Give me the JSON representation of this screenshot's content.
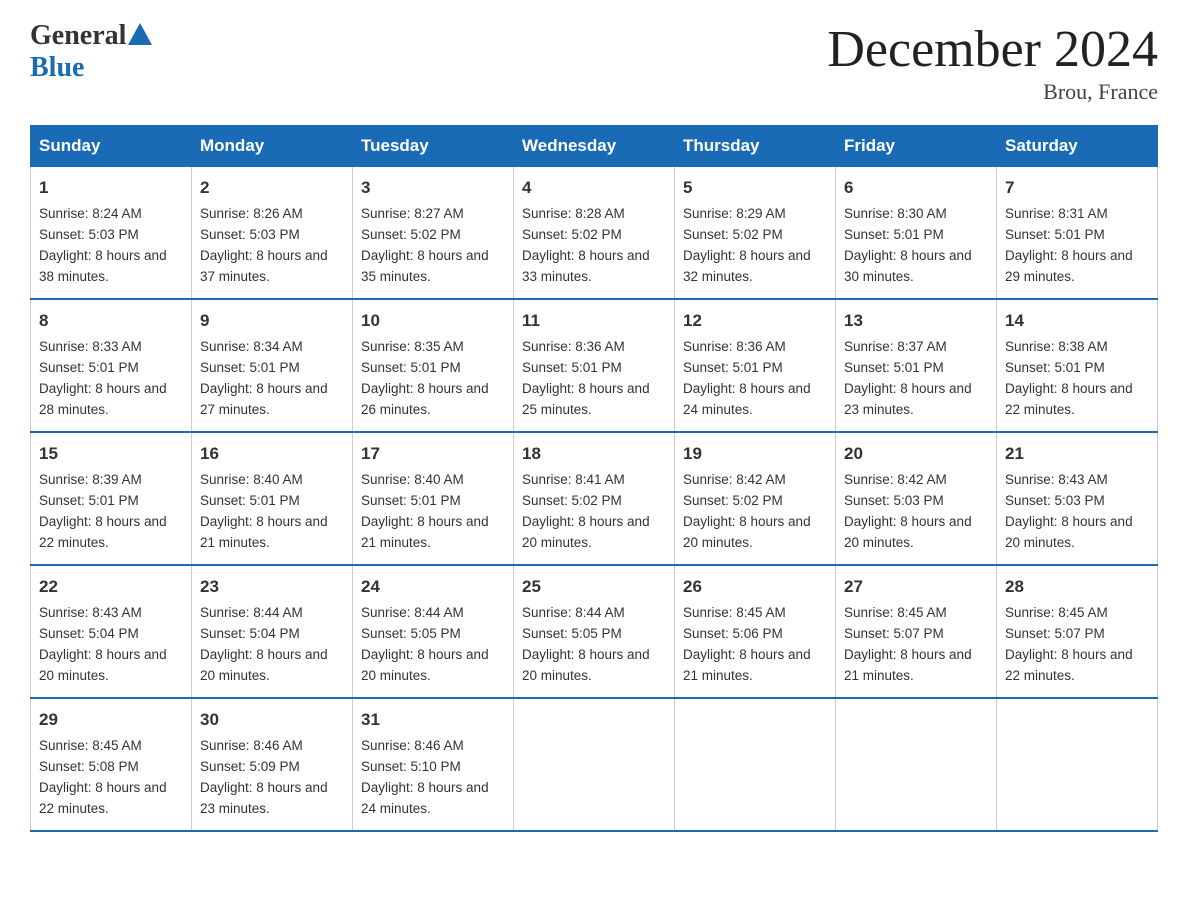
{
  "header": {
    "logo_general": "General",
    "logo_blue": "Blue",
    "title": "December 2024",
    "location": "Brou, France"
  },
  "days_of_week": [
    "Sunday",
    "Monday",
    "Tuesday",
    "Wednesday",
    "Thursday",
    "Friday",
    "Saturday"
  ],
  "weeks": [
    [
      {
        "day": "1",
        "sunrise": "Sunrise: 8:24 AM",
        "sunset": "Sunset: 5:03 PM",
        "daylight": "Daylight: 8 hours and 38 minutes."
      },
      {
        "day": "2",
        "sunrise": "Sunrise: 8:26 AM",
        "sunset": "Sunset: 5:03 PM",
        "daylight": "Daylight: 8 hours and 37 minutes."
      },
      {
        "day": "3",
        "sunrise": "Sunrise: 8:27 AM",
        "sunset": "Sunset: 5:02 PM",
        "daylight": "Daylight: 8 hours and 35 minutes."
      },
      {
        "day": "4",
        "sunrise": "Sunrise: 8:28 AM",
        "sunset": "Sunset: 5:02 PM",
        "daylight": "Daylight: 8 hours and 33 minutes."
      },
      {
        "day": "5",
        "sunrise": "Sunrise: 8:29 AM",
        "sunset": "Sunset: 5:02 PM",
        "daylight": "Daylight: 8 hours and 32 minutes."
      },
      {
        "day": "6",
        "sunrise": "Sunrise: 8:30 AM",
        "sunset": "Sunset: 5:01 PM",
        "daylight": "Daylight: 8 hours and 30 minutes."
      },
      {
        "day": "7",
        "sunrise": "Sunrise: 8:31 AM",
        "sunset": "Sunset: 5:01 PM",
        "daylight": "Daylight: 8 hours and 29 minutes."
      }
    ],
    [
      {
        "day": "8",
        "sunrise": "Sunrise: 8:33 AM",
        "sunset": "Sunset: 5:01 PM",
        "daylight": "Daylight: 8 hours and 28 minutes."
      },
      {
        "day": "9",
        "sunrise": "Sunrise: 8:34 AM",
        "sunset": "Sunset: 5:01 PM",
        "daylight": "Daylight: 8 hours and 27 minutes."
      },
      {
        "day": "10",
        "sunrise": "Sunrise: 8:35 AM",
        "sunset": "Sunset: 5:01 PM",
        "daylight": "Daylight: 8 hours and 26 minutes."
      },
      {
        "day": "11",
        "sunrise": "Sunrise: 8:36 AM",
        "sunset": "Sunset: 5:01 PM",
        "daylight": "Daylight: 8 hours and 25 minutes."
      },
      {
        "day": "12",
        "sunrise": "Sunrise: 8:36 AM",
        "sunset": "Sunset: 5:01 PM",
        "daylight": "Daylight: 8 hours and 24 minutes."
      },
      {
        "day": "13",
        "sunrise": "Sunrise: 8:37 AM",
        "sunset": "Sunset: 5:01 PM",
        "daylight": "Daylight: 8 hours and 23 minutes."
      },
      {
        "day": "14",
        "sunrise": "Sunrise: 8:38 AM",
        "sunset": "Sunset: 5:01 PM",
        "daylight": "Daylight: 8 hours and 22 minutes."
      }
    ],
    [
      {
        "day": "15",
        "sunrise": "Sunrise: 8:39 AM",
        "sunset": "Sunset: 5:01 PM",
        "daylight": "Daylight: 8 hours and 22 minutes."
      },
      {
        "day": "16",
        "sunrise": "Sunrise: 8:40 AM",
        "sunset": "Sunset: 5:01 PM",
        "daylight": "Daylight: 8 hours and 21 minutes."
      },
      {
        "day": "17",
        "sunrise": "Sunrise: 8:40 AM",
        "sunset": "Sunset: 5:01 PM",
        "daylight": "Daylight: 8 hours and 21 minutes."
      },
      {
        "day": "18",
        "sunrise": "Sunrise: 8:41 AM",
        "sunset": "Sunset: 5:02 PM",
        "daylight": "Daylight: 8 hours and 20 minutes."
      },
      {
        "day": "19",
        "sunrise": "Sunrise: 8:42 AM",
        "sunset": "Sunset: 5:02 PM",
        "daylight": "Daylight: 8 hours and 20 minutes."
      },
      {
        "day": "20",
        "sunrise": "Sunrise: 8:42 AM",
        "sunset": "Sunset: 5:03 PM",
        "daylight": "Daylight: 8 hours and 20 minutes."
      },
      {
        "day": "21",
        "sunrise": "Sunrise: 8:43 AM",
        "sunset": "Sunset: 5:03 PM",
        "daylight": "Daylight: 8 hours and 20 minutes."
      }
    ],
    [
      {
        "day": "22",
        "sunrise": "Sunrise: 8:43 AM",
        "sunset": "Sunset: 5:04 PM",
        "daylight": "Daylight: 8 hours and 20 minutes."
      },
      {
        "day": "23",
        "sunrise": "Sunrise: 8:44 AM",
        "sunset": "Sunset: 5:04 PM",
        "daylight": "Daylight: 8 hours and 20 minutes."
      },
      {
        "day": "24",
        "sunrise": "Sunrise: 8:44 AM",
        "sunset": "Sunset: 5:05 PM",
        "daylight": "Daylight: 8 hours and 20 minutes."
      },
      {
        "day": "25",
        "sunrise": "Sunrise: 8:44 AM",
        "sunset": "Sunset: 5:05 PM",
        "daylight": "Daylight: 8 hours and 20 minutes."
      },
      {
        "day": "26",
        "sunrise": "Sunrise: 8:45 AM",
        "sunset": "Sunset: 5:06 PM",
        "daylight": "Daylight: 8 hours and 21 minutes."
      },
      {
        "day": "27",
        "sunrise": "Sunrise: 8:45 AM",
        "sunset": "Sunset: 5:07 PM",
        "daylight": "Daylight: 8 hours and 21 minutes."
      },
      {
        "day": "28",
        "sunrise": "Sunrise: 8:45 AM",
        "sunset": "Sunset: 5:07 PM",
        "daylight": "Daylight: 8 hours and 22 minutes."
      }
    ],
    [
      {
        "day": "29",
        "sunrise": "Sunrise: 8:45 AM",
        "sunset": "Sunset: 5:08 PM",
        "daylight": "Daylight: 8 hours and 22 minutes."
      },
      {
        "day": "30",
        "sunrise": "Sunrise: 8:46 AM",
        "sunset": "Sunset: 5:09 PM",
        "daylight": "Daylight: 8 hours and 23 minutes."
      },
      {
        "day": "31",
        "sunrise": "Sunrise: 8:46 AM",
        "sunset": "Sunset: 5:10 PM",
        "daylight": "Daylight: 8 hours and 24 minutes."
      },
      {
        "day": "",
        "sunrise": "",
        "sunset": "",
        "daylight": ""
      },
      {
        "day": "",
        "sunrise": "",
        "sunset": "",
        "daylight": ""
      },
      {
        "day": "",
        "sunrise": "",
        "sunset": "",
        "daylight": ""
      },
      {
        "day": "",
        "sunrise": "",
        "sunset": "",
        "daylight": ""
      }
    ]
  ]
}
